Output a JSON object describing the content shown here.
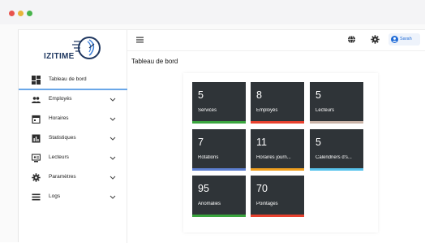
{
  "logo": {
    "text": "IZITIME"
  },
  "sidebar": {
    "items": [
      {
        "label": "Tableau de bord",
        "icon": "dashboard-icon",
        "active": true,
        "has_chevron": false
      },
      {
        "label": "Employés",
        "icon": "people-icon",
        "has_chevron": true
      },
      {
        "label": "Horaires",
        "icon": "calendar-icon",
        "has_chevron": true
      },
      {
        "label": "Statistiques",
        "icon": "bar-chart-icon",
        "has_chevron": true
      },
      {
        "label": "Lecteurs",
        "icon": "reader-icon",
        "has_chevron": true
      },
      {
        "label": "Paramètres",
        "icon": "gear-icon",
        "has_chevron": true
      },
      {
        "label": "Logs",
        "icon": "list-icon",
        "has_chevron": true
      }
    ]
  },
  "topbar": {
    "user_name": "Sarah"
  },
  "page": {
    "title": "Tableau de bord"
  },
  "cards": [
    {
      "value": "5",
      "label": "Services",
      "color": "#3aa53e"
    },
    {
      "value": "8",
      "label": "Employés",
      "color": "#e8412e"
    },
    {
      "value": "5",
      "label": "Lecteurs",
      "color": "#c9b3a7"
    },
    {
      "value": "7",
      "label": "Rotations",
      "color": "#5d7fd0"
    },
    {
      "value": "11",
      "label": "Horaires journ...",
      "color": "#f0a020"
    },
    {
      "value": "5",
      "label": "Calendriers d's...",
      "color": "#58c3ec"
    },
    {
      "value": "95",
      "label": "Anomalies",
      "color": "#3aa53e"
    },
    {
      "value": "70",
      "label": "Pointages",
      "color": "#e8412e"
    }
  ],
  "colors": {
    "accent": "#1e6ad6",
    "card_bg": "#2f3438"
  }
}
